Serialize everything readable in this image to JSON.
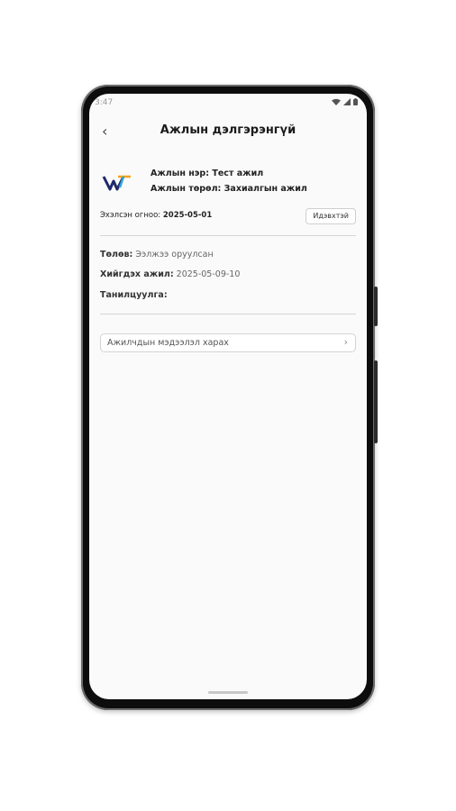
{
  "status_bar": {
    "time": "3:47"
  },
  "header": {
    "title": "Ажлын дэлгэрэнгүй",
    "back": "‹"
  },
  "job": {
    "name_label": "Ажлын нэр:",
    "name_value": "Тест ажил",
    "type_label": "Ажлын төрөл:",
    "type_value": "Захиалгын ажил",
    "start_label": "Эхэлсэн огноо:",
    "start_value": "2025-05-01",
    "status_button": "Идэвхтэй"
  },
  "details": {
    "state_label": "Төлөв:",
    "state_value": "Ээлжээ оруулсан",
    "work_label": "Хийгдэх ажил:",
    "work_value": "2025-05-09-10",
    "intro_label": "Танилцуулга:"
  },
  "employee_link": {
    "label": "Ажилчдын мэдээлэл харах",
    "chevron": "›"
  },
  "colors": {
    "logo_blue": "#1f2a6b",
    "logo_orange": "#f4a21d",
    "logo_cyan": "#2ea5d8"
  }
}
